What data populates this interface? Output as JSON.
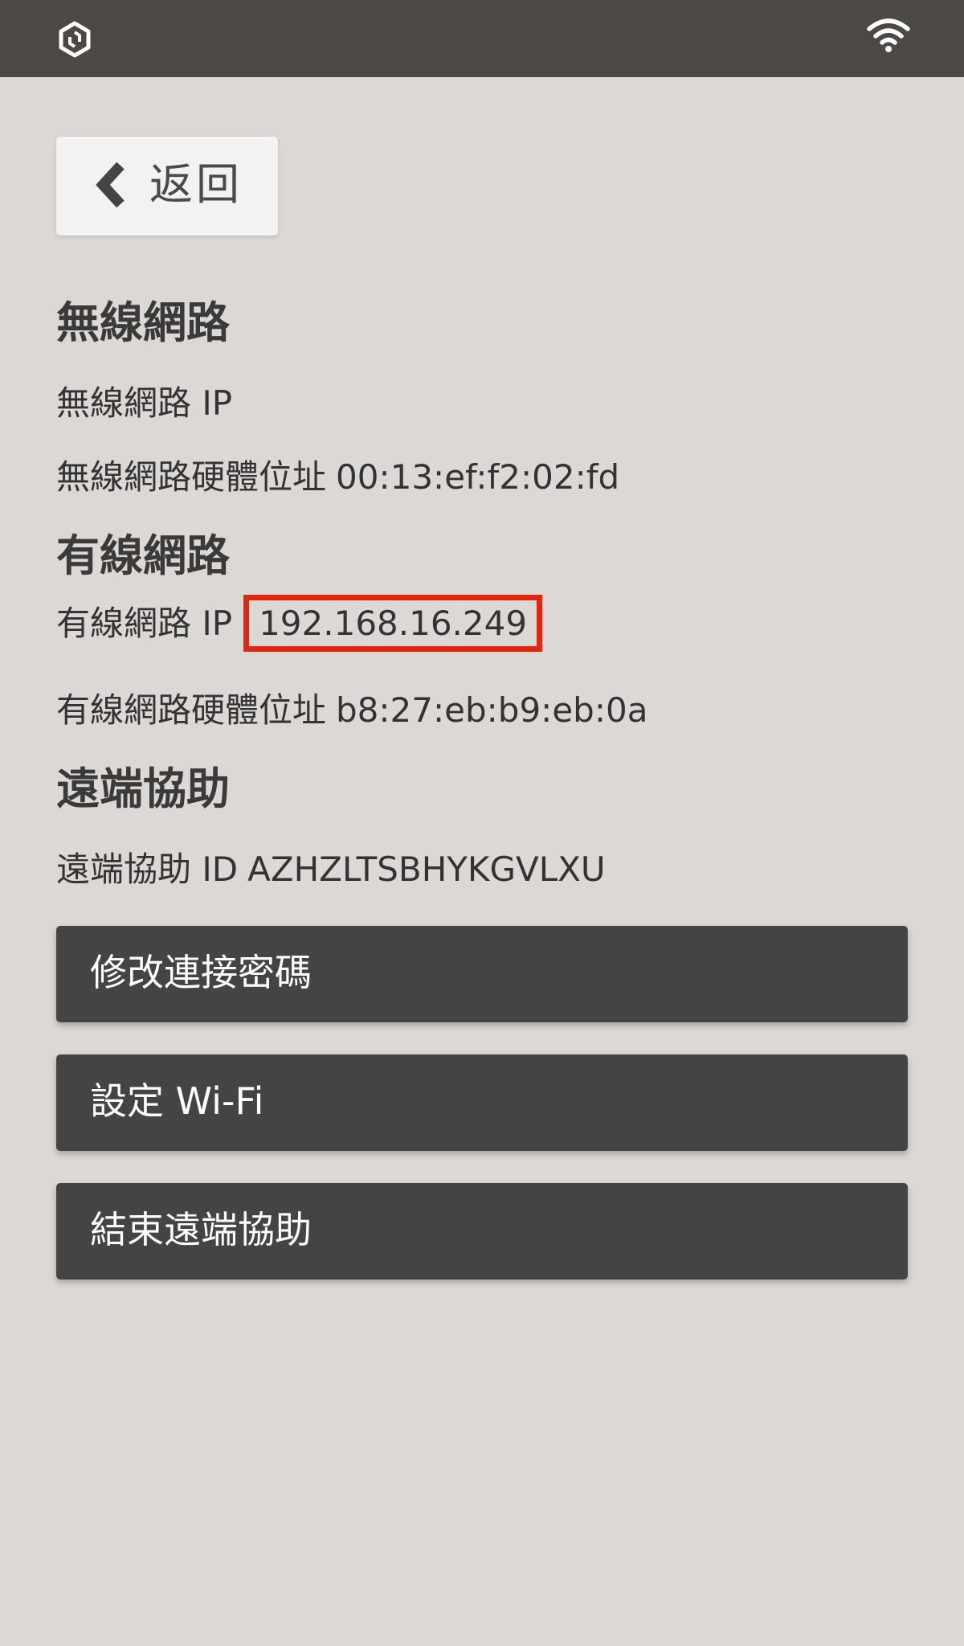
{
  "status_bar": {
    "logo_icon": "app-logo-icon",
    "wifi_icon": "wifi-icon"
  },
  "back_button": {
    "label": "返回",
    "icon": "chevron-left-icon"
  },
  "wireless": {
    "heading": "無線網路",
    "ip_label": "無線網路 IP",
    "ip_value": "",
    "mac_label": "無線網路硬體位址",
    "mac_value": "00:13:ef:f2:02:fd"
  },
  "wired": {
    "heading": "有線網路",
    "ip_label": "有線網路 IP",
    "ip_value": "192.168.16.249",
    "mac_label": "有線網路硬體位址",
    "mac_value": "b8:27:eb:b9:eb:0a"
  },
  "remote": {
    "heading": "遠端協助",
    "id_label": "遠端協助 ID",
    "id_value": "AZHZLTSBHYKGVLXU"
  },
  "buttons": {
    "change_password": "修改連接密碼",
    "setup_wifi": "設定 Wi-Fi",
    "end_remote": "結束遠端協助"
  },
  "colors": {
    "status_bar": "#4b4846",
    "background": "#dcd8d5",
    "button_dark": "#444444",
    "highlight_border": "#e2260f"
  }
}
